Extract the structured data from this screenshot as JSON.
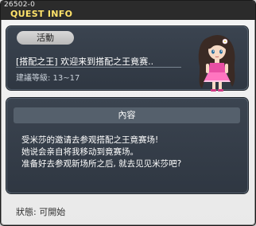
{
  "window": {
    "quest_id": "26502-0",
    "title": "QUEST INFO"
  },
  "quest": {
    "category": "活動",
    "name": "[搭配之王] 欢迎来到搭配之王竟赛..",
    "level_text": "建議等級: 13~17"
  },
  "content": {
    "header": "內容",
    "lines": [
      "受米莎的邀请去参观搭配之王竟赛场!",
      "她说会亲自将我移动到竟赛场。",
      "准备好去参观新场所之后, 就去见见米莎吧?"
    ]
  },
  "status": {
    "text": "狀態: 可開始"
  },
  "colors": {
    "title_accent": "#ffe36a",
    "panel_bg": "#353e49",
    "header_bg": "#55606c",
    "window_bg": "#efefef"
  },
  "icons": {
    "npc": "npc-portrait-icon"
  }
}
